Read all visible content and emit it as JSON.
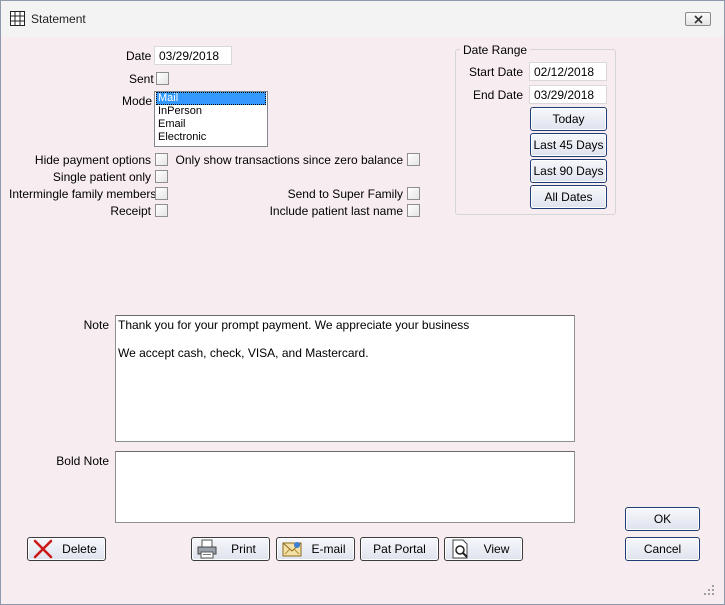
{
  "window": {
    "title": "Statement"
  },
  "form": {
    "date_label": "Date",
    "date_value": "03/29/2018",
    "sent_label": "Sent",
    "mode_label": "Mode",
    "mode_options": [
      "Mail",
      "InPerson",
      "Email",
      "Electronic"
    ],
    "mode_selected": "Mail",
    "hide_payment_label": "Hide payment options",
    "single_patient_label": "Single patient only",
    "intermingle_label": "Intermingle family members",
    "receipt_label": "Receipt",
    "zero_balance_label": "Only show transactions since zero balance",
    "super_family_label": "Send to Super Family",
    "include_last_name_label": "Include patient last name"
  },
  "date_range": {
    "title": "Date Range",
    "start_label": "Start Date",
    "start_value": "02/12/2018",
    "end_label": "End Date",
    "end_value": "03/29/2018",
    "today_label": "Today",
    "last45_label": "Last 45 Days",
    "last90_label": "Last 90 Days",
    "all_label": "All Dates"
  },
  "note": {
    "label": "Note",
    "lines": [
      "Thank you for your prompt payment. We appreciate your business",
      "",
      "We accept cash, check, VISA, and Mastercard."
    ]
  },
  "bold_note": {
    "label": "Bold Note",
    "value": ""
  },
  "buttons": {
    "delete": "Delete",
    "print": "Print",
    "email": "E-mail",
    "pat_portal": "Pat Portal",
    "view": "View",
    "ok": "OK",
    "cancel": "Cancel"
  },
  "colors": {
    "background": "#f7ecf0",
    "selection": "#3399ff",
    "delete_icon": "#cc1a1a"
  }
}
